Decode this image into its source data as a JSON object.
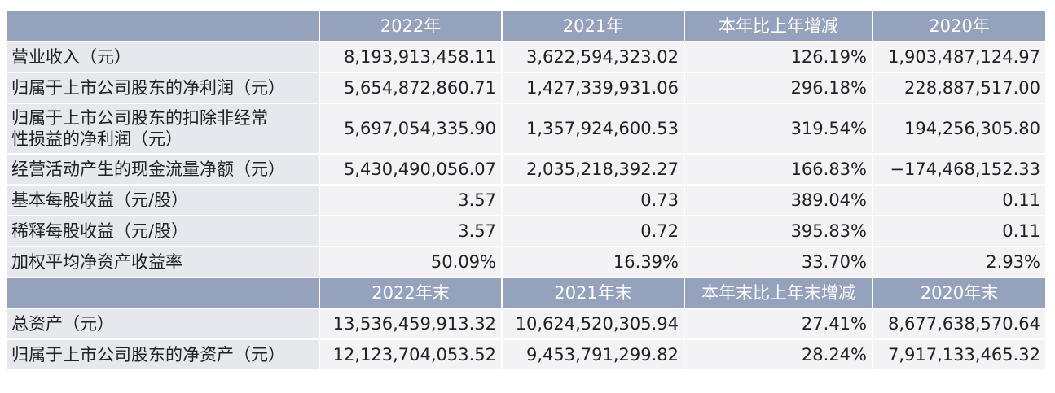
{
  "header1": [
    "",
    "2022年",
    "2021年",
    "本年比上年增减",
    "2020年"
  ],
  "rows1": [
    {
      "label": [
        "营业收入（元）"
      ],
      "values": [
        "8,193,913,458.11",
        "3,622,594,323.02",
        "126.19%",
        "1,903,487,124.97"
      ]
    },
    {
      "label": [
        "归属于上市公司股东的净利润（元）"
      ],
      "values": [
        "5,654,872,860.71",
        "1,427,339,931.06",
        "296.18%",
        "228,887,517.00"
      ]
    },
    {
      "label": [
        "归属于上市公司股东的扣除非经常",
        "性损益的净利润（元）"
      ],
      "values": [
        "5,697,054,335.90",
        "1,357,924,600.53",
        "319.54%",
        "194,256,305.80"
      ]
    },
    {
      "label": [
        "经营活动产生的现金流量净额（元）"
      ],
      "values": [
        "5,430,490,056.07",
        "2,035,218,392.27",
        "166.83%",
        "−174,468,152.33"
      ]
    },
    {
      "label": [
        "基本每股收益（元/股）"
      ],
      "values": [
        "3.57",
        "0.73",
        "389.04%",
        "0.11"
      ]
    },
    {
      "label": [
        "稀释每股收益（元/股）"
      ],
      "values": [
        "3.57",
        "0.72",
        "395.83%",
        "0.11"
      ]
    },
    {
      "label": [
        "加权平均净资产收益率"
      ],
      "values": [
        "50.09%",
        "16.39%",
        "33.70%",
        "2.93%"
      ]
    }
  ],
  "header2": [
    "",
    "2022年末",
    "2021年末",
    "本年末比上年末增减",
    "2020年末"
  ],
  "rows2": [
    {
      "label": [
        "总资产（元）"
      ],
      "values": [
        "13,536,459,913.32",
        "10,624,520,305.94",
        "27.41%",
        "8,677,638,570.64"
      ]
    },
    {
      "label": [
        "归属于上市公司股东的净资产（元）"
      ],
      "values": [
        "12,123,704,053.52",
        "9,453,791,299.82",
        "28.24%",
        "7,917,133,465.32"
      ]
    }
  ]
}
